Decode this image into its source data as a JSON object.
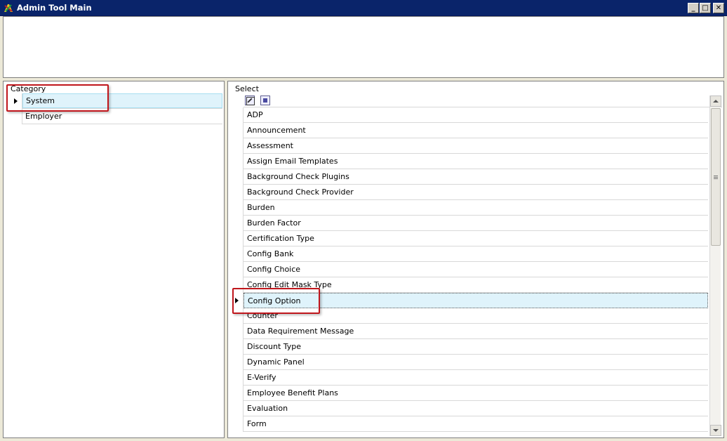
{
  "window": {
    "title": "Admin Tool Main",
    "minimize_glyph": "_",
    "maximize_glyph": "□",
    "close_glyph": "✕"
  },
  "category": {
    "caption": "Category",
    "items": [
      {
        "label": "System",
        "selected": true
      },
      {
        "label": "Employer",
        "selected": false
      }
    ]
  },
  "select": {
    "caption": "Select",
    "items": [
      {
        "label": "ADP"
      },
      {
        "label": "Announcement"
      },
      {
        "label": "Assessment"
      },
      {
        "label": "Assign Email Templates"
      },
      {
        "label": "Background Check Plugins"
      },
      {
        "label": "Background Check Provider"
      },
      {
        "label": "Burden"
      },
      {
        "label": "Burden Factor"
      },
      {
        "label": "Certification Type"
      },
      {
        "label": "Config Bank"
      },
      {
        "label": "Config Choice"
      },
      {
        "label": "Config Edit Mask Type"
      },
      {
        "label": "Config Option",
        "selected": true
      },
      {
        "label": "Counter"
      },
      {
        "label": "Data Requirement Message"
      },
      {
        "label": "Discount Type"
      },
      {
        "label": "Dynamic Panel"
      },
      {
        "label": "E-Verify"
      },
      {
        "label": "Employee Benefit Plans"
      },
      {
        "label": "Evaluation"
      },
      {
        "label": "Form"
      }
    ]
  },
  "colors": {
    "titlebar": "#0a246a",
    "selected_row": "#dff3fb",
    "highlight_box": "#c0161c"
  }
}
